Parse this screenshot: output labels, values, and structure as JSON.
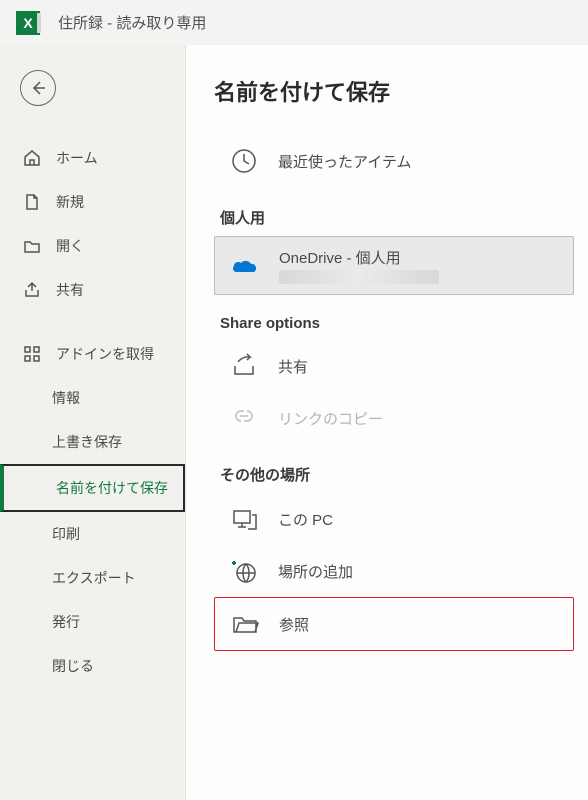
{
  "titlebar": {
    "document": "住所録",
    "separator": " - ",
    "mode": "読み取り専用"
  },
  "sidebar": {
    "items": [
      {
        "label": "ホーム"
      },
      {
        "label": "新規"
      },
      {
        "label": "開く"
      },
      {
        "label": "共有"
      },
      {
        "label": "アドインを取得"
      },
      {
        "label": "情報"
      },
      {
        "label": "上書き保存"
      },
      {
        "label": "名前を付けて保存"
      },
      {
        "label": "印刷"
      },
      {
        "label": "エクスポート"
      },
      {
        "label": "発行"
      },
      {
        "label": "閉じる"
      }
    ]
  },
  "main": {
    "heading": "名前を付けて保存",
    "recent_label": "最近使ったアイテム",
    "personal_header": "個人用",
    "onedrive_label": "OneDrive - 個人用",
    "share_header": "Share options",
    "share_label": "共有",
    "copylink_label": "リンクのコピー",
    "other_header": "その他の場所",
    "thispc_label": "この PC",
    "addplace_label": "場所の追加",
    "browse_label": "参照"
  }
}
